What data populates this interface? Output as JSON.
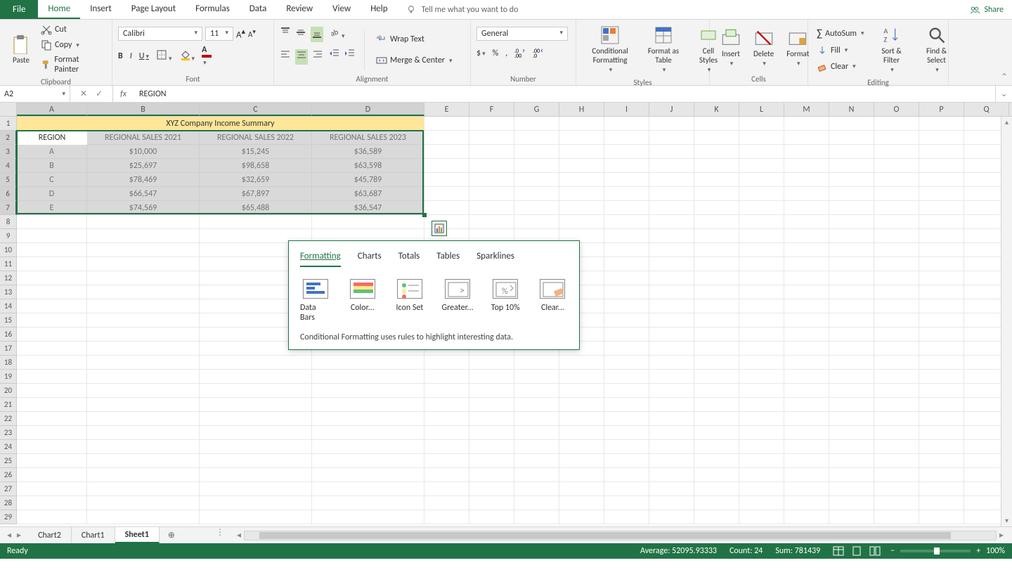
{
  "tabs": {
    "file": "File",
    "home": "Home",
    "insert": "Insert",
    "page_layout": "Page Layout",
    "formulas": "Formulas",
    "data": "Data",
    "review": "Review",
    "view": "View",
    "help": "Help"
  },
  "tell_me": "Tell me what you want to do",
  "share": "Share",
  "clipboard": {
    "paste": "Paste",
    "cut": "Cut",
    "copy": "Copy",
    "format_painter": "Format Painter",
    "label": "Clipboard"
  },
  "font": {
    "name": "Calibri",
    "size": "11",
    "label": "Font"
  },
  "alignment": {
    "wrap": "Wrap Text",
    "merge": "Merge & Center",
    "label": "Alignment"
  },
  "number": {
    "format": "General",
    "label": "Number"
  },
  "styles": {
    "cond": "Conditional Formatting",
    "table": "Format as Table",
    "cell": "Cell Styles",
    "label": "Styles"
  },
  "cells_group": {
    "insert": "Insert",
    "delete": "Delete",
    "format": "Format",
    "label": "Cells"
  },
  "editing": {
    "autosum": "AutoSum",
    "fill": "Fill",
    "clear": "Clear",
    "sort": "Sort & Filter",
    "find": "Find & Select",
    "label": "Editing"
  },
  "name_box": "A2",
  "formula_value": "REGION",
  "columns": [
    "A",
    "B",
    "C",
    "D",
    "E",
    "F",
    "G",
    "H",
    "I",
    "J",
    "K",
    "L",
    "M",
    "N",
    "O",
    "P",
    "Q"
  ],
  "col_widths": {
    "A": 100,
    "B": 160,
    "C": 160,
    "D": 160,
    "rest": 64
  },
  "row_count": 29,
  "sel_cols": [
    "A",
    "B",
    "C",
    "D"
  ],
  "sel_rows": [
    2,
    3,
    4,
    5,
    6,
    7
  ],
  "sheet": {
    "title_row": "XYZ Company Income Summary",
    "headers": [
      "REGION",
      "REGIONAL SALES 2021",
      "REGIONAL SALES 2022",
      "REGIONAL SALES 2023"
    ],
    "rows": [
      {
        "region": "A",
        "y2021": "$10,000",
        "y2022": "$15,245",
        "y2023": "$36,589"
      },
      {
        "region": "B",
        "y2021": "$25,697",
        "y2022": "$98,658",
        "y2023": "$63,598"
      },
      {
        "region": "C",
        "y2021": "$78,469",
        "y2022": "$32,659",
        "y2023": "$45,789"
      },
      {
        "region": "D",
        "y2021": "$66,547",
        "y2022": "$67,897",
        "y2023": "$63,687"
      },
      {
        "region": "E",
        "y2021": "$74,569",
        "y2022": "$65,488",
        "y2023": "$36,547"
      }
    ]
  },
  "qa": {
    "tabs": [
      "Formatting",
      "Charts",
      "Totals",
      "Tables",
      "Sparklines"
    ],
    "items": [
      "Data Bars",
      "Color...",
      "Icon Set",
      "Greater...",
      "Top 10%",
      "Clear..."
    ],
    "desc": "Conditional Formatting uses rules to highlight interesting data."
  },
  "sheet_tabs": [
    "Chart2",
    "Chart1",
    "Sheet1"
  ],
  "active_sheet": "Sheet1",
  "status": {
    "ready": "Ready",
    "avg_label": "Average:",
    "avg": "52095.93333",
    "count_label": "Count:",
    "count": "24",
    "sum_label": "Sum:",
    "sum": "781439",
    "zoom": "100%"
  }
}
